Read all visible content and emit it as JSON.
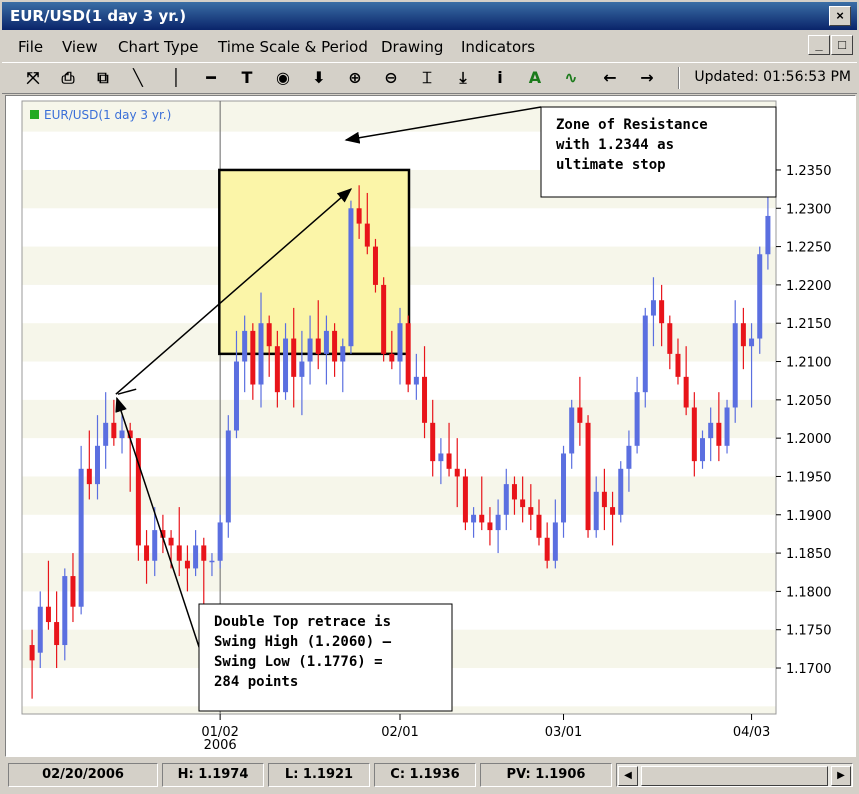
{
  "window": {
    "title": "EUR/USD(1 day  3 yr.)",
    "close_glyph": "×",
    "minimize_glyph": "_",
    "maximize_glyph": "□"
  },
  "menu": [
    "File",
    "View",
    "Chart Type",
    "Time Scale & Period",
    "Drawing",
    "Indicators"
  ],
  "toolbar": {
    "tools": [
      {
        "icon": "axis-icon",
        "glyph": "⤧"
      },
      {
        "icon": "print-icon",
        "glyph": "⎙"
      },
      {
        "icon": "copy-icon",
        "glyph": "⧉"
      },
      {
        "icon": "trend-line-icon",
        "glyph": "╲"
      },
      {
        "icon": "vertical-line-icon",
        "glyph": "│"
      },
      {
        "icon": "horizontal-line-icon",
        "glyph": "━"
      },
      {
        "icon": "text-icon",
        "glyph": "T"
      },
      {
        "icon": "point-icon",
        "glyph": "◉"
      },
      {
        "icon": "down-arrow-icon",
        "glyph": "⬇"
      },
      {
        "icon": "zoom-in-icon",
        "glyph": "⊕"
      },
      {
        "icon": "zoom-out-icon",
        "glyph": "⊖"
      },
      {
        "icon": "fit-icon",
        "glyph": "⌶"
      },
      {
        "icon": "download-icon",
        "glyph": "⤓"
      },
      {
        "icon": "info-icon",
        "glyph": "i"
      },
      {
        "icon": "label-icon",
        "glyph": "A"
      },
      {
        "icon": "indicator-icon",
        "glyph": "∿"
      },
      {
        "icon": "left-arrow-icon",
        "glyph": "←"
      },
      {
        "icon": "right-arrow-icon",
        "glyph": "→"
      }
    ],
    "updated": "Updated: 01:56:53 PM"
  },
  "status": {
    "date": "02/20/2006",
    "high": "H: 1.1974",
    "low": "L: 1.1921",
    "close": "C: 1.1936",
    "pv": "PV: 1.1906"
  },
  "chart_data": {
    "type": "candlestick",
    "legend": "EUR/USD(1 day  3 yr.)",
    "legend_color": "#22aa22",
    "up_color": "#5b6fe0",
    "down_color": "#e8141a",
    "ylim": [
      1.164,
      1.244
    ],
    "y_ticks": [
      1.17,
      1.175,
      1.18,
      1.185,
      1.19,
      1.195,
      1.2,
      1.205,
      1.21,
      1.215,
      1.22,
      1.225,
      1.23,
      1.235
    ],
    "y_tick_labels": [
      "1.1700",
      "1.1750",
      "1.1800",
      "1.1850",
      "1.1900",
      "1.1950",
      "1.2000",
      "1.2050",
      "1.2100",
      "1.2150",
      "1.2200",
      "1.2250",
      "1.2300",
      "1.2350"
    ],
    "x_ticks": [
      {
        "index": 23,
        "label": "01/02",
        "sublabel": "2006"
      },
      {
        "index": 45,
        "label": "02/01",
        "sublabel": ""
      },
      {
        "index": 65,
        "label": "03/01",
        "sublabel": ""
      },
      {
        "index": 88,
        "label": "04/03",
        "sublabel": ""
      }
    ],
    "candles": [
      [
        1.173,
        1.175,
        1.166,
        1.171
      ],
      [
        1.172,
        1.18,
        1.17,
        1.178
      ],
      [
        1.178,
        1.184,
        1.175,
        1.176
      ],
      [
        1.176,
        1.18,
        1.17,
        1.173
      ],
      [
        1.173,
        1.183,
        1.171,
        1.182
      ],
      [
        1.182,
        1.185,
        1.176,
        1.178
      ],
      [
        1.178,
        1.199,
        1.177,
        1.196
      ],
      [
        1.196,
        1.201,
        1.192,
        1.194
      ],
      [
        1.194,
        1.203,
        1.192,
        1.199
      ],
      [
        1.199,
        1.206,
        1.196,
        1.202
      ],
      [
        1.202,
        1.205,
        1.199,
        1.2
      ],
      [
        1.2,
        1.203,
        1.198,
        1.201
      ],
      [
        1.201,
        1.202,
        1.193,
        1.2
      ],
      [
        1.2,
        1.2,
        1.184,
        1.186
      ],
      [
        1.186,
        1.188,
        1.181,
        1.184
      ],
      [
        1.184,
        1.191,
        1.182,
        1.188
      ],
      [
        1.188,
        1.19,
        1.185,
        1.187
      ],
      [
        1.187,
        1.188,
        1.183,
        1.186
      ],
      [
        1.186,
        1.191,
        1.182,
        1.184
      ],
      [
        1.184,
        1.186,
        1.18,
        1.183
      ],
      [
        1.183,
        1.188,
        1.182,
        1.186
      ],
      [
        1.186,
        1.187,
        1.178,
        1.184
      ],
      [
        1.184,
        1.185,
        1.182,
        1.184
      ],
      [
        1.184,
        1.19,
        1.183,
        1.189
      ],
      [
        1.189,
        1.203,
        1.187,
        1.201
      ],
      [
        1.201,
        1.214,
        1.2,
        1.21
      ],
      [
        1.21,
        1.216,
        1.206,
        1.214
      ],
      [
        1.214,
        1.215,
        1.205,
        1.207
      ],
      [
        1.207,
        1.219,
        1.204,
        1.215
      ],
      [
        1.215,
        1.216,
        1.208,
        1.212
      ],
      [
        1.212,
        1.214,
        1.204,
        1.206
      ],
      [
        1.206,
        1.215,
        1.205,
        1.213
      ],
      [
        1.213,
        1.217,
        1.204,
        1.208
      ],
      [
        1.208,
        1.214,
        1.203,
        1.21
      ],
      [
        1.21,
        1.216,
        1.207,
        1.213
      ],
      [
        1.213,
        1.218,
        1.209,
        1.211
      ],
      [
        1.211,
        1.216,
        1.207,
        1.214
      ],
      [
        1.214,
        1.215,
        1.208,
        1.21
      ],
      [
        1.21,
        1.213,
        1.206,
        1.212
      ],
      [
        1.212,
        1.231,
        1.211,
        1.23
      ],
      [
        1.23,
        1.233,
        1.226,
        1.228
      ],
      [
        1.228,
        1.232,
        1.224,
        1.225
      ],
      [
        1.225,
        1.226,
        1.219,
        1.22
      ],
      [
        1.22,
        1.221,
        1.21,
        1.211
      ],
      [
        1.211,
        1.214,
        1.209,
        1.21
      ],
      [
        1.21,
        1.217,
        1.207,
        1.215
      ]
    ],
    "candles_b": [
      [
        1.215,
        1.216,
        1.206,
        1.207
      ],
      [
        1.207,
        1.211,
        1.205,
        1.208
      ],
      [
        1.208,
        1.212,
        1.2,
        1.202
      ],
      [
        1.202,
        1.205,
        1.195,
        1.197
      ],
      [
        1.197,
        1.2,
        1.194,
        1.198
      ],
      [
        1.198,
        1.202,
        1.195,
        1.196
      ],
      [
        1.196,
        1.2,
        1.191,
        1.195
      ],
      [
        1.195,
        1.196,
        1.188,
        1.189
      ],
      [
        1.189,
        1.191,
        1.187,
        1.19
      ],
      [
        1.19,
        1.195,
        1.188,
        1.189
      ],
      [
        1.189,
        1.191,
        1.186,
        1.188
      ],
      [
        1.188,
        1.192,
        1.185,
        1.19
      ],
      [
        1.19,
        1.196,
        1.188,
        1.194
      ],
      [
        1.194,
        1.195,
        1.19,
        1.192
      ],
      [
        1.192,
        1.195,
        1.189,
        1.191
      ],
      [
        1.191,
        1.194,
        1.188,
        1.19
      ],
      [
        1.19,
        1.192,
        1.186,
        1.187
      ],
      [
        1.187,
        1.189,
        1.183,
        1.184
      ],
      [
        1.184,
        1.192,
        1.183,
        1.189
      ],
      [
        1.189,
        1.199,
        1.187,
        1.198
      ],
      [
        1.198,
        1.205,
        1.196,
        1.204
      ],
      [
        1.204,
        1.208,
        1.199,
        1.202
      ],
      [
        1.202,
        1.203,
        1.187,
        1.188
      ],
      [
        1.188,
        1.195,
        1.187,
        1.193
      ],
      [
        1.193,
        1.196,
        1.188,
        1.191
      ],
      [
        1.191,
        1.193,
        1.186,
        1.19
      ],
      [
        1.19,
        1.197,
        1.189,
        1.196
      ],
      [
        1.196,
        1.201,
        1.193,
        1.199
      ],
      [
        1.199,
        1.208,
        1.198,
        1.206
      ],
      [
        1.206,
        1.217,
        1.204,
        1.216
      ],
      [
        1.216,
        1.221,
        1.212,
        1.218
      ],
      [
        1.218,
        1.22,
        1.212,
        1.215
      ],
      [
        1.215,
        1.216,
        1.209,
        1.211
      ],
      [
        1.211,
        1.213,
        1.207,
        1.208
      ],
      [
        1.208,
        1.212,
        1.203,
        1.204
      ],
      [
        1.204,
        1.206,
        1.195,
        1.197
      ],
      [
        1.197,
        1.201,
        1.196,
        1.2
      ],
      [
        1.2,
        1.204,
        1.197,
        1.202
      ],
      [
        1.202,
        1.206,
        1.197,
        1.199
      ],
      [
        1.199,
        1.205,
        1.198,
        1.204
      ],
      [
        1.204,
        1.218,
        1.202,
        1.215
      ],
      [
        1.215,
        1.217,
        1.209,
        1.212
      ],
      [
        1.212,
        1.215,
        1.204,
        1.213
      ],
      [
        1.213,
        1.225,
        1.211,
        1.224
      ],
      [
        1.224,
        1.232,
        1.222,
        1.229
      ]
    ],
    "resistance_zone": {
      "top": 1.235,
      "bottom": 1.211
    },
    "annotations": [
      {
        "id": "resistance",
        "lines": [
          "Zone of Resistance",
          "with 1.2344 as",
          "ultimate stop"
        ]
      },
      {
        "id": "double-top",
        "lines": [
          "Double Top retrace is",
          "Swing High (1.2060) –",
          "Swing Low (1.1776) =",
          "284 points"
        ]
      }
    ]
  }
}
